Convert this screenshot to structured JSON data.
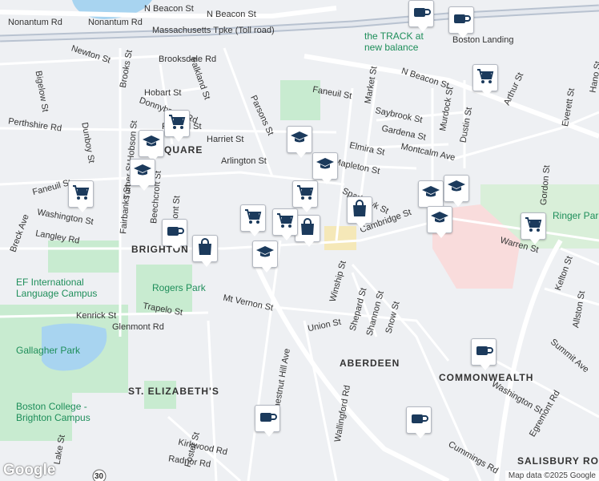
{
  "map": {
    "attribution": "Map data ©2025 Google",
    "logo": "Google",
    "neighborhoods": [
      "BRIGHTON",
      "ABERDEEN",
      "ST. ELIZABETH'S",
      "COMMONWEALTH",
      "SALISBURY ROAD -",
      "SQUARE"
    ],
    "streets": [
      "Nonantum Rd",
      "Nonantum Rd",
      "N Beacon St",
      "N Beacon St",
      "N Beacon St",
      "Massachusetts Tpke (Toll road)",
      "Newton St",
      "Brooksdale Rd",
      "Brooks St",
      "Hobart St",
      "Falkland St",
      "Donnybrook Rd",
      "Faneuil St",
      "Faneuil St",
      "Faneuil St",
      "Bigelow St",
      "Dunboy St",
      "Perthshire Rd",
      "Harriet St",
      "Parsons St",
      "Arlington St",
      "Hobson St",
      "Turner St",
      "Beechcroft St",
      "Fairbanks St",
      "Washington St",
      "Washington St",
      "Breck Ave",
      "Langley Rd",
      "Kenrick St",
      "Tremont St",
      "Trapelo St",
      "Glenmont Rd",
      "Mt Vernon St",
      "Chestnut Hill Ave",
      "Market St",
      "Saybrook St",
      "Gardena St",
      "Montcalm Ave",
      "Murdock St",
      "Dustin St",
      "Elmira St",
      "Mapleton St",
      "Sparhawk St",
      "Cambridge St",
      "Warren St",
      "Winship St",
      "Shepard St",
      "Shannon St",
      "Snow St",
      "Union St",
      "Wallingford Rd",
      "Foster St",
      "Kirkwood Rd",
      "Radnor Rd",
      "Lake St",
      "Cummings Rd",
      "Egremont Rd",
      "Summit Ave",
      "Kelton St",
      "Allston St",
      "Gordon St",
      "Everett St",
      "Arthur St",
      "Hano St"
    ],
    "places": [
      "EF International Language Campus",
      "Rogers Park",
      "Gallagher Park",
      "Boston College - Brighton Campus",
      "the TRACK at new balance",
      "Boston Landing",
      "Ringer Park"
    ],
    "highway_shield": "30",
    "colors": {
      "road": "#ffffff",
      "highway": "#b8c2d0",
      "park": "#c8ebd0",
      "water": "#a8d4f0",
      "hospital": "#f9dcdc",
      "marker_icon": "#1b3a5c",
      "poi_green": "#1e8e5a"
    }
  },
  "markers": [
    {
      "icon": "coffee-icon"
    },
    {
      "icon": "coffee-icon"
    },
    {
      "icon": "grocery-cart-icon"
    },
    {
      "icon": "grocery-cart-icon"
    },
    {
      "icon": "school-icon"
    },
    {
      "icon": "grocery-cart-icon"
    },
    {
      "icon": "school-icon"
    },
    {
      "icon": "school-icon"
    },
    {
      "icon": "grocery-cart-icon"
    },
    {
      "icon": "school-icon"
    },
    {
      "icon": "shopping-bag-icon"
    },
    {
      "icon": "coffee-icon"
    },
    {
      "icon": "shopping-bag-icon"
    },
    {
      "icon": "school-icon"
    },
    {
      "icon": "grocery-cart-icon"
    },
    {
      "icon": "shopping-bag-icon"
    },
    {
      "icon": "school-icon"
    },
    {
      "icon": "school-icon"
    },
    {
      "icon": "school-icon"
    },
    {
      "icon": "grocery-cart-icon"
    },
    {
      "icon": "coffee-icon"
    },
    {
      "icon": "coffee-icon"
    },
    {
      "icon": "coffee-icon"
    },
    {
      "icon": "grocery-cart-icon"
    }
  ]
}
